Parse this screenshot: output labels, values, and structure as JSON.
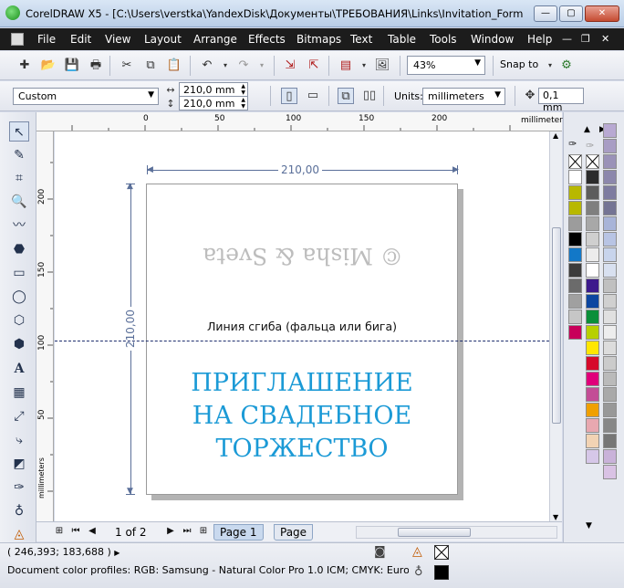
{
  "window": {
    "title": "CorelDRAW X5 - [C:\\Users\\verstka\\YandexDisk\\Документы\\ТРЕБОВАНИЯ\\Links\\Invitation_Format_Ex...",
    "min_glyph": "—",
    "max_glyph": "▢",
    "close_glyph": "✕"
  },
  "menu": {
    "items": [
      "File",
      "Edit",
      "View",
      "Layout",
      "Arrange",
      "Effects",
      "Bitmaps",
      "Text",
      "Table",
      "Tools",
      "Window",
      "Help"
    ],
    "mdi_min": "—",
    "mdi_restore": "❐",
    "mdi_close": "✕"
  },
  "standard_toolbar": {
    "zoom_value": "43%",
    "snap_label": "Snap to"
  },
  "property_bar": {
    "preset": "Custom",
    "width": "210,0 mm",
    "height": "210,0 mm",
    "units_label": "Units:",
    "units_value": "millimeters",
    "nudge_value": "0,1 mm"
  },
  "rulers": {
    "unit": "millimeters",
    "h_labels": [
      "0",
      "50",
      "100",
      "150",
      "200"
    ],
    "v_labels": [
      "200",
      "150",
      "100",
      "50"
    ],
    "v_unit": "millimeters"
  },
  "document": {
    "dim_width": "210,00",
    "dim_height": "210,00",
    "mirror_text": "© Misha & Sveta",
    "fold_label": "Линия сгиба (фальца или бига)",
    "invite_line1": "ПРИГЛАШЕНИЕ",
    "invite_line2": "НА СВАДЕБНОЕ",
    "invite_line3": "ТОРЖЕСТВО"
  },
  "page_nav": {
    "count": "1 of 2",
    "tabs": [
      "Page 1",
      "Page"
    ]
  },
  "status": {
    "coords": "( 246,393; 183,688 )",
    "coords_arrow": "▶",
    "profile": "Document color profiles: RGB: Samsung - Natural Color Pro 1.0 ICM; CMYK: Eurostanda..."
  },
  "colors": {
    "accent_text": "#1b9ad6",
    "dimension": "#5a6f99",
    "palette_left": [
      "#ffffff",
      "#b8b800",
      "#b8b800",
      "#9c9c9c",
      "#000000",
      "#1278c8",
      "#3c3c3c",
      "#6b6b6b",
      "#a0a0a0",
      "#c6c6c6",
      "#c8005a"
    ],
    "palette_mid": [
      "#2b2b2b",
      "#5c5c5c",
      "#7f7f7f",
      "#a8a8a8",
      "#cfcfcf",
      "#ececec",
      "#ffffff",
      "#3d1a8c",
      "#0c46a0",
      "#0b8f3a",
      "#b7d000",
      "#ffe600",
      "#d60a2a",
      "#e0007a",
      "#c34d96",
      "#f0a000",
      "#e8a8b0",
      "#f2d3b4",
      "#d6c7e8"
    ],
    "palette_right": [
      "#b8a9d2",
      "#a89dc4",
      "#9a92b8",
      "#8c87ac",
      "#7e7ca0",
      "#747494",
      "#a8b4d8",
      "#b8c4e4",
      "#c8d4ec",
      "#d8e0f0",
      "#c0c0c0",
      "#d0d0d0",
      "#e0e0e0",
      "#ededed",
      "#dcdcdc",
      "#cbcbcb",
      "#bababa",
      "#a9a9a9",
      "#989898",
      "#878787",
      "#767676",
      "#c9b2d9",
      "#d9c2e4"
    ]
  }
}
